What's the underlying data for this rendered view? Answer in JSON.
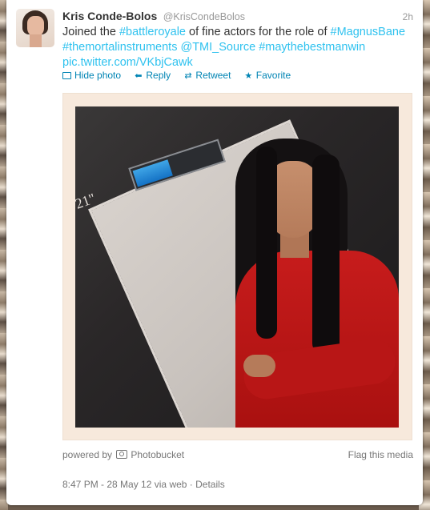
{
  "tweet": {
    "display_name": "Kris Conde-Bolos",
    "handle": "@KrisCondeBolos",
    "time": "2h",
    "text": {
      "line1": {
        "a": "Joined the ",
        "hashtag1": "#battleroyale",
        "b": " of fine actors for the role of ",
        "hashtag2": "#MagnusBane"
      },
      "line2": {
        "hashtag3": "#themortalinstruments",
        "mention": "@TMI_Source",
        "hashtag4": "#maythebestmanwin"
      },
      "line3": {
        "link": "pic.twitter.com/VKbjCawk"
      }
    }
  },
  "actions": {
    "hide_photo": "Hide photo",
    "reply": "Reply",
    "retweet": "Retweet",
    "favorite": "Favorite"
  },
  "media": {
    "screen_label": "21\"",
    "progress_fraction": 0.42,
    "powered_by": "powered by",
    "provider": "Photobucket",
    "flag": "Flag this media"
  },
  "meta": {
    "time": "8:47 PM",
    "date": "28 May 12",
    "via": "via web",
    "details": "Details"
  },
  "colors": {
    "link": "#2fc2ef",
    "action": "#0084b4",
    "text": "#333333",
    "muted": "#999999"
  }
}
